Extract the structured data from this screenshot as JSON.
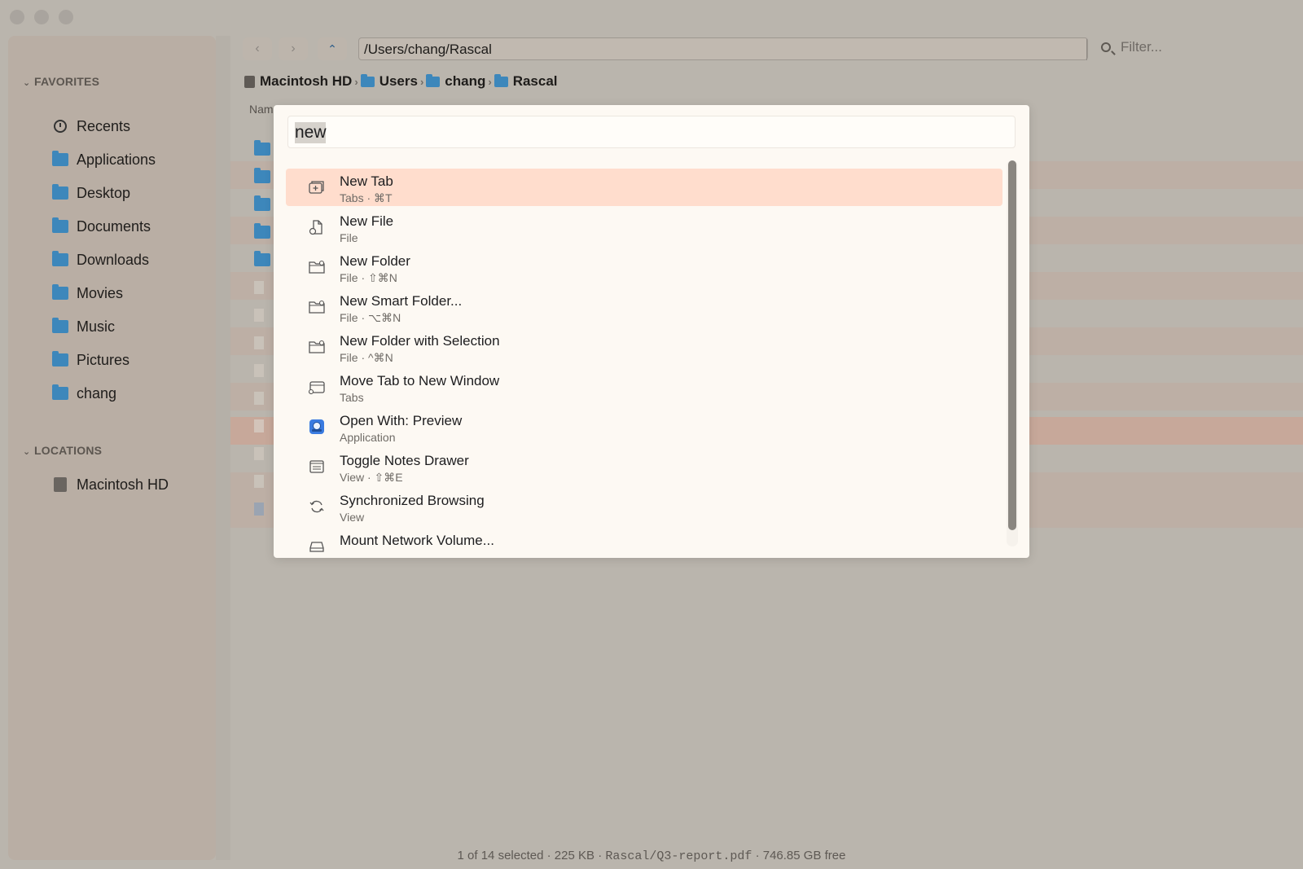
{
  "sidebar": {
    "favorites_label": "FAVORITES",
    "favorites": [
      {
        "label": "Recents",
        "icon": "clock-icon"
      },
      {
        "label": "Applications",
        "icon": "folder-icon"
      },
      {
        "label": "Desktop",
        "icon": "folder-icon"
      },
      {
        "label": "Documents",
        "icon": "folder-icon"
      },
      {
        "label": "Downloads",
        "icon": "folder-icon"
      },
      {
        "label": "Movies",
        "icon": "folder-icon"
      },
      {
        "label": "Music",
        "icon": "folder-icon"
      },
      {
        "label": "Pictures",
        "icon": "folder-icon"
      },
      {
        "label": "chang",
        "icon": "folder-icon"
      }
    ],
    "locations_label": "LOCATIONS",
    "locations": [
      {
        "label": "Macintosh HD",
        "icon": "disk-icon"
      }
    ]
  },
  "toolbar": {
    "path": "/Users/chang/Rascal",
    "filter_placeholder": "Filter..."
  },
  "breadcrumb": [
    "Macintosh HD",
    "Users",
    "chang",
    "Rascal"
  ],
  "list": {
    "column_name": "Nam"
  },
  "palette": {
    "query": "new",
    "results": [
      {
        "title": "New Tab",
        "subtitle": "Tabs · ⌘T",
        "icon": "new-tab-icon",
        "selected": true
      },
      {
        "title": "New File",
        "subtitle": "File",
        "icon": "new-file-icon"
      },
      {
        "title": "New Folder",
        "subtitle": "File · ⇧⌘N",
        "icon": "new-folder-icon"
      },
      {
        "title": "New Smart Folder...",
        "subtitle": "File · ⌥⌘N",
        "icon": "smart-folder-icon"
      },
      {
        "title": "New Folder with Selection",
        "subtitle": "File · ^⌘N",
        "icon": "folder-selection-icon"
      },
      {
        "title": "Move Tab to New Window",
        "subtitle": "Tabs",
        "icon": "window-icon"
      },
      {
        "title": "Open With: Preview",
        "subtitle": "Application",
        "icon": "preview-app-icon"
      },
      {
        "title": "Toggle Notes Drawer",
        "subtitle": "View · ⇧⌘E",
        "icon": "notes-icon"
      },
      {
        "title": "Synchronized Browsing",
        "subtitle": "View",
        "icon": "sync-icon"
      },
      {
        "title": "Mount Network Volume...",
        "subtitle": "",
        "icon": "network-drive-icon"
      }
    ]
  },
  "status": {
    "selection": "1 of 14 selected",
    "size": "225  KB",
    "path": "Rascal/Q3-report.pdf",
    "free": "746.85 GB free"
  },
  "colors": {
    "selection_highlight": "#ffddcd",
    "folder_blue": "#3d87bb",
    "palette_bg": "#fdf9f3"
  }
}
